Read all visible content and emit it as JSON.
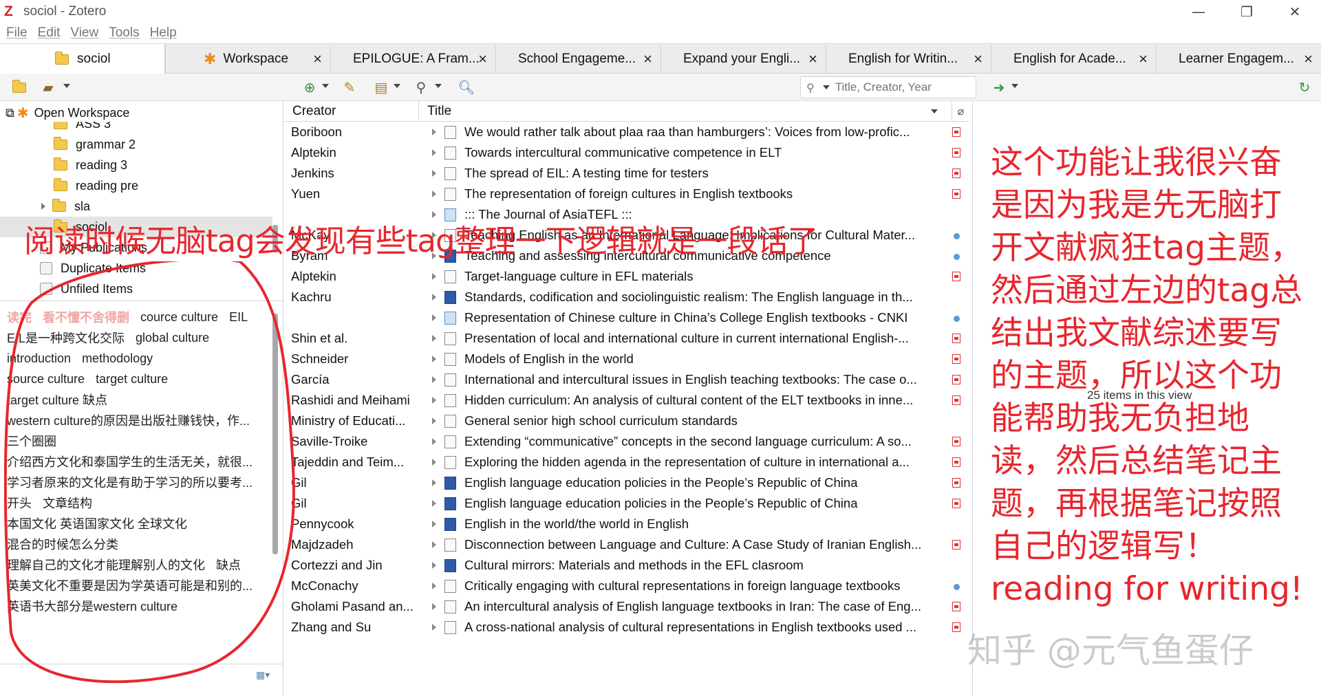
{
  "window": {
    "title": "sociol - Zotero",
    "logo_letter": "Z"
  },
  "menu": [
    "File",
    "Edit",
    "View",
    "Tools",
    "Help"
  ],
  "tabs": [
    {
      "label": "sociol",
      "active": true
    },
    {
      "label": "Workspace"
    },
    {
      "label": "EPILOGUE: A Fram..."
    },
    {
      "label": "School Engageme..."
    },
    {
      "label": "Expand your Engli..."
    },
    {
      "label": "English for Writin..."
    },
    {
      "label": "English for Acade..."
    },
    {
      "label": "Learner Engagem..."
    }
  ],
  "toolbar": {
    "search_placeholder": "Title, Creator, Year"
  },
  "left": {
    "open_workspace": "Open Workspace",
    "collections": [
      {
        "label": "ASS 3"
      },
      {
        "label": "grammar 2"
      },
      {
        "label": "reading 3"
      },
      {
        "label": "reading pre"
      },
      {
        "label": "sla"
      },
      {
        "label": "sociol"
      },
      {
        "label": "My Publications"
      },
      {
        "label": "Duplicate Items"
      },
      {
        "label": "Unfiled Items"
      }
    ],
    "tag_rows": [
      [
        "读完",
        "看不懂不舍得删",
        "cource culture",
        "EIL"
      ],
      [
        "EIL是一种跨文化交际",
        "global culture"
      ],
      [
        "introduction",
        "methodology"
      ],
      [
        "source culture",
        "target culture"
      ],
      [
        "target culture 缺点"
      ],
      [
        "western culture的原因是出版社赚钱快，作..."
      ],
      [
        "三个圈圈"
      ],
      [
        "介绍西方文化和泰国学生的生活无关，就很..."
      ],
      [
        "学习者原来的文化是有助于学习的所以要考..."
      ],
      [
        "开头",
        "文章结构"
      ],
      [
        "本国文化 英语国家文化 全球文化"
      ],
      [
        "混合的时候怎么分类"
      ],
      [
        "理解自己的文化才能理解别人的文化",
        "缺点"
      ],
      [
        "英美文化不重要是因为学英语可能是和别的..."
      ],
      [
        "英语书大部分是western culture"
      ]
    ]
  },
  "table": {
    "col_creator": "Creator",
    "col_title": "Title",
    "rows": [
      {
        "creator": "Boriboon",
        "title": "We would rather talk about plaa raa than hamburgers’: Voices from low-profic...",
        "type": "journal",
        "att": "pdf"
      },
      {
        "creator": "Alptekin",
        "title": "Towards intercultural communicative competence in ELT",
        "type": "journal",
        "att": "pdf"
      },
      {
        "creator": "Jenkins",
        "title": "The spread of EIL: A testing time for testers",
        "type": "journal",
        "att": "pdf"
      },
      {
        "creator": "Yuen",
        "title": "The representation of foreign cultures in English textbooks",
        "type": "journal",
        "att": "pdf"
      },
      {
        "creator": "",
        "title": "::: The Journal of AsiaTEFL :::",
        "type": "web",
        "att": ""
      },
      {
        "creator": "McKay",
        "title": "Teaching English as an International Language: Implications for Cultural Mater...",
        "type": "journal",
        "att": "dot"
      },
      {
        "creator": "Byram",
        "title": "Teaching and assessing intercultural communicative competence",
        "type": "book",
        "att": "dot"
      },
      {
        "creator": "Alptekin",
        "title": "Target-language culture in EFL materials",
        "type": "journal",
        "att": "pdf"
      },
      {
        "creator": "Kachru",
        "title": "Standards, codification and sociolinguistic realism: The English language in th...",
        "type": "book",
        "att": ""
      },
      {
        "creator": "",
        "title": "Representation of Chinese culture in China’s College English textbooks - CNKI",
        "type": "web",
        "att": "dot"
      },
      {
        "creator": "Shin et al.",
        "title": "Presentation of local and international culture in current international English-...",
        "type": "journal",
        "att": "pdf"
      },
      {
        "creator": "Schneider",
        "title": "Models of English in the world",
        "type": "journal",
        "att": "pdf"
      },
      {
        "creator": "García",
        "title": "International and intercultural issues in English teaching textbooks: The case o...",
        "type": "journal",
        "att": "pdf"
      },
      {
        "creator": "Rashidi and Meihami",
        "title": "Hidden curriculum: An analysis of cultural content of the ELT textbooks in inne...",
        "type": "journal",
        "att": "pdf"
      },
      {
        "creator": "Ministry of Educati...",
        "title": "General senior high school curriculum standards",
        "type": "doc",
        "att": ""
      },
      {
        "creator": "Saville-Troike",
        "title": "Extending “communicative” concepts in the second language curriculum: A so...",
        "type": "journal",
        "att": "pdf"
      },
      {
        "creator": "Tajeddin and Teim...",
        "title": "Exploring the hidden agenda in the representation of culture in international a...",
        "type": "journal",
        "att": "pdf"
      },
      {
        "creator": "Gil",
        "title": "English language education policies in the People’s Republic of China",
        "type": "book",
        "att": "pdf"
      },
      {
        "creator": "Gil",
        "title": "English language education policies in the People’s Republic of China",
        "type": "book",
        "att": "pdf"
      },
      {
        "creator": "Pennycook",
        "title": "English in the world/the world in English",
        "type": "book",
        "att": ""
      },
      {
        "creator": "Majdzadeh",
        "title": "Disconnection between Language and Culture: A Case Study of Iranian English...",
        "type": "journal",
        "att": "pdf"
      },
      {
        "creator": "Cortezzi and Jin",
        "title": "Cultural mirrors: Materials and methods in the EFL clasroom",
        "type": "book",
        "att": ""
      },
      {
        "creator": "McConachy",
        "title": "Critically engaging with cultural representations in foreign language textbooks",
        "type": "journal",
        "att": "dot"
      },
      {
        "creator": "Gholami Pasand an...",
        "title": "An intercultural analysis of English language textbooks in Iran: The case of Eng...",
        "type": "journal",
        "att": "pdf"
      },
      {
        "creator": "Zhang and Su",
        "title": "A cross-national analysis of cultural representations in English textbooks used ...",
        "type": "journal",
        "att": "pdf"
      }
    ]
  },
  "item_count": "25 items in this view",
  "annotations": {
    "left": "阅读时候无脑tag会发现有些tag整理一下逻辑就是一段话了",
    "right": [
      "这个功能让我很兴奋",
      "是因为我是先无脑打",
      "开文献疯狂tag主题，",
      "然后通过左边的tag总",
      "结出我文献综述要写",
      "的主题，所以这个功",
      "能帮助我无负担地",
      "读，然后总结笔记主",
      "题，再根据笔记按照",
      "自己的逻辑写！"
    ],
    "right_en": "reading for writing!",
    "watermark": "知乎 @元气鱼蛋仔"
  },
  "colors": {
    "annotation": "#e8262d",
    "accent": "#2f5aa8"
  }
}
